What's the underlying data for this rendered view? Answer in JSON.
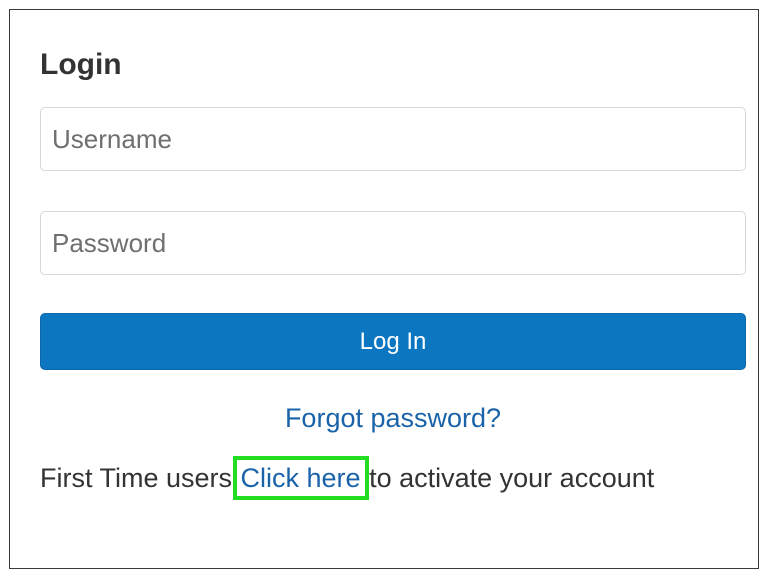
{
  "login": {
    "title": "Login",
    "username_placeholder": "Username",
    "password_placeholder": "Password",
    "submit_label": "Log In",
    "forgot_label": "Forgot password?",
    "first_time_prefix": "First Time users ",
    "activate_link_label": "Click here",
    "first_time_suffix": " to activate your account"
  },
  "colors": {
    "primary_button": "#0d76c0",
    "link": "#1a63a8",
    "highlight": "#22dd22"
  }
}
